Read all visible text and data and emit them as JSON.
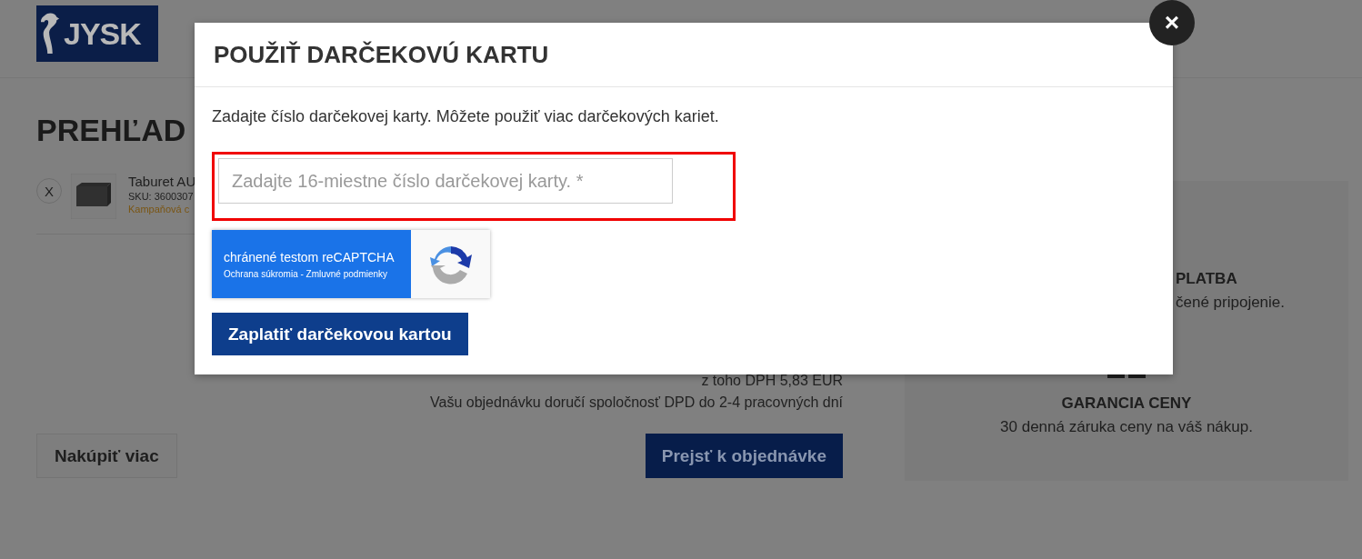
{
  "header": {
    "logo": "JYSK"
  },
  "page": {
    "title": "PREHĽAD",
    "cart_item": {
      "remove": "X",
      "name": "Taburet AU",
      "sku": "SKU: 3600307",
      "campaign": "Kampaňová c"
    },
    "summary": [
      "z toho DPH 5,83 EUR",
      "Vašu objednávku doručí spoločnosť DPD do 2-4 pracovných dní"
    ],
    "continue_button": "Nakúpiť viac",
    "checkout_button": "Prejsť k objednávke"
  },
  "benefits": [
    {
      "title": "PLATBA",
      "text": "čené pripojenie."
    },
    {
      "title": "GARANCIA CENY",
      "text": "30 denná záruka ceny na váš nákup."
    }
  ],
  "modal": {
    "title": "POUŽIŤ DARČEKOVÚ KARTU",
    "close": "×",
    "instruction": "Zadajte číslo darčekovej karty. Môžete použiť viac darčekových kariet.",
    "card_field": {
      "placeholder": "Zadajte 16-miestne číslo darčekovej karty. *",
      "highlighted": true
    },
    "recaptcha": {
      "title": "chránené testom reCAPTCHA",
      "links": "Ochrana súkromia - Zmluvné podmienky"
    },
    "pay_button": "Zaplatiť darčekovou kartou"
  }
}
